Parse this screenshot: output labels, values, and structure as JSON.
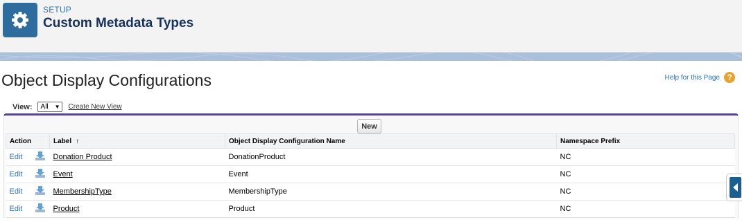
{
  "header": {
    "section": "SETUP",
    "title": "Custom Metadata Types",
    "icon": "gear-icon",
    "icon_color": "#2e6c9e"
  },
  "page": {
    "title": "Object Display Configurations",
    "help_link": "Help for this Page",
    "help_icon": "question-icon"
  },
  "view": {
    "label": "View:",
    "selected": "All",
    "create_link": "Create New View"
  },
  "list": {
    "new_button": "New",
    "accent_color": "#56458c",
    "columns": [
      "Action",
      "Label",
      "Object Display Configuration Name",
      "Namespace Prefix"
    ],
    "sort_indicator": "↑",
    "rows": [
      {
        "action": "Edit",
        "label": "Donation Product",
        "name": "DonationProduct",
        "prefix": "NC"
      },
      {
        "action": "Edit",
        "label": "Event",
        "name": "Event",
        "prefix": "NC"
      },
      {
        "action": "Edit",
        "label": "MembershipType",
        "name": "MembershipType",
        "prefix": "NC"
      },
      {
        "action": "Edit",
        "label": "Product",
        "name": "Product",
        "prefix": "NC"
      }
    ]
  }
}
